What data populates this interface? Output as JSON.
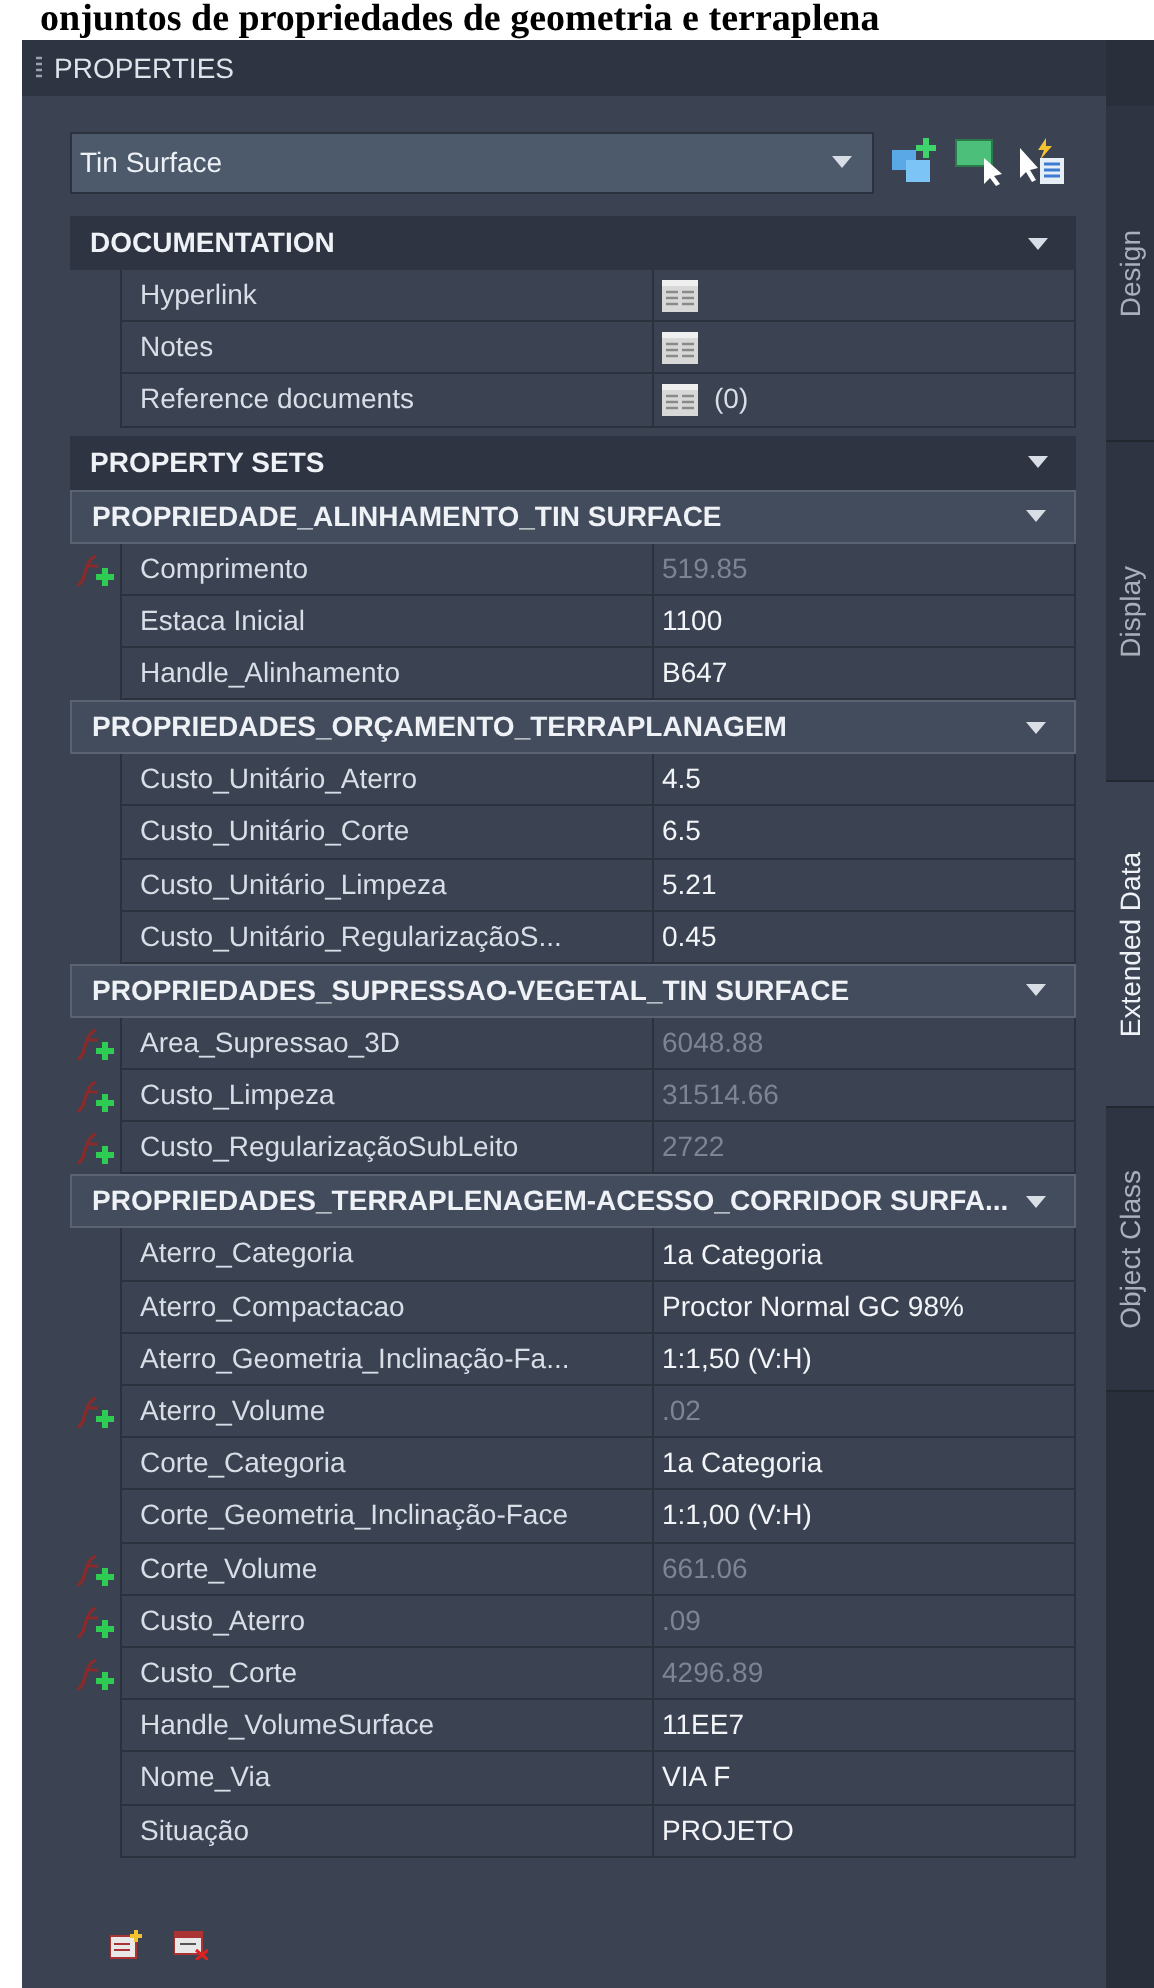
{
  "caption": "onjuntos de propriedades de geometria e terraplena",
  "palette": {
    "title": "PROPERTIES"
  },
  "object_selector": {
    "value": "Tin Surface"
  },
  "side_tabs": [
    {
      "label": "Design",
      "selected": false
    },
    {
      "label": "Display",
      "selected": false
    },
    {
      "label": "Extended Data",
      "selected": true
    },
    {
      "label": "Object Class",
      "selected": false
    }
  ],
  "documentation": {
    "title": "DOCUMENTATION",
    "expanded": true,
    "rows": [
      {
        "label": "Hyperlink"
      },
      {
        "label": "Notes"
      },
      {
        "label": "Reference documents",
        "value": "(0)"
      }
    ]
  },
  "property_sets": {
    "title": "PROPERTY SETS",
    "expanded": true,
    "sets": [
      {
        "title": "PROPRIEDADE_ALINHAMENTO_TIN SURFACE",
        "expanded": true,
        "rows": [
          {
            "label": "Comprimento",
            "value": "519.85",
            "calculated": true
          },
          {
            "label": "Estaca Inicial",
            "value": "1100",
            "calculated": false
          },
          {
            "label": "Handle_Alinhamento",
            "value": "B647",
            "calculated": false
          }
        ]
      },
      {
        "title": "PROPRIEDADES_ORÇAMENTO_TERRAPLANAGEM",
        "expanded": true,
        "rows": [
          {
            "label": "Custo_Unitário_Aterro",
            "value": "4.5",
            "calculated": false
          },
          {
            "label": "Custo_Unitário_Corte",
            "value": "6.5",
            "calculated": false
          },
          {
            "label": "Custo_Unitário_Limpeza",
            "value": "5.21",
            "calculated": false
          },
          {
            "label": "Custo_Unitário_RegularizaçãoS...",
            "value": "0.45",
            "calculated": false
          }
        ]
      },
      {
        "title": "PROPRIEDADES_SUPRESSAO-VEGETAL_TIN SURFACE",
        "expanded": true,
        "rows": [
          {
            "label": "Area_Supressao_3D",
            "value": "6048.88",
            "calculated": true
          },
          {
            "label": "Custo_Limpeza",
            "value": "31514.66",
            "calculated": true
          },
          {
            "label": "Custo_RegularizaçãoSubLeito",
            "value": "2722",
            "calculated": true
          }
        ]
      },
      {
        "title": "PROPRIEDADES_TERRAPLENAGEM-ACESSO_CORRIDOR  SURFA...",
        "expanded": true,
        "rows": [
          {
            "label": "Aterro_Categoria",
            "value": "1a Categoria",
            "calculated": false
          },
          {
            "label": "Aterro_Compactacao",
            "value": "Proctor Normal GC 98%",
            "calculated": false
          },
          {
            "label": "Aterro_Geometria_Inclinação-Fa...",
            "value": "1:1,50 (V:H)",
            "calculated": false
          },
          {
            "label": "Aterro_Volume",
            "value": ".02",
            "calculated": true
          },
          {
            "label": "Corte_Categoria",
            "value": "1a Categoria",
            "calculated": false
          },
          {
            "label": "Corte_Geometria_Inclinação-Face",
            "value": "1:1,00 (V:H)",
            "calculated": false
          },
          {
            "label": "Corte_Volume",
            "value": "661.06",
            "calculated": true
          },
          {
            "label": "Custo_Aterro",
            "value": ".09",
            "calculated": true
          },
          {
            "label": "Custo_Corte",
            "value": "4296.89",
            "calculated": true
          },
          {
            "label": "Handle_VolumeSurface",
            "value": "11EE7",
            "calculated": false
          },
          {
            "label": "Nome_Via",
            "value": "VIA F",
            "calculated": false
          },
          {
            "label": "Situação",
            "value": "PROJETO",
            "calculated": false
          }
        ]
      }
    ]
  }
}
